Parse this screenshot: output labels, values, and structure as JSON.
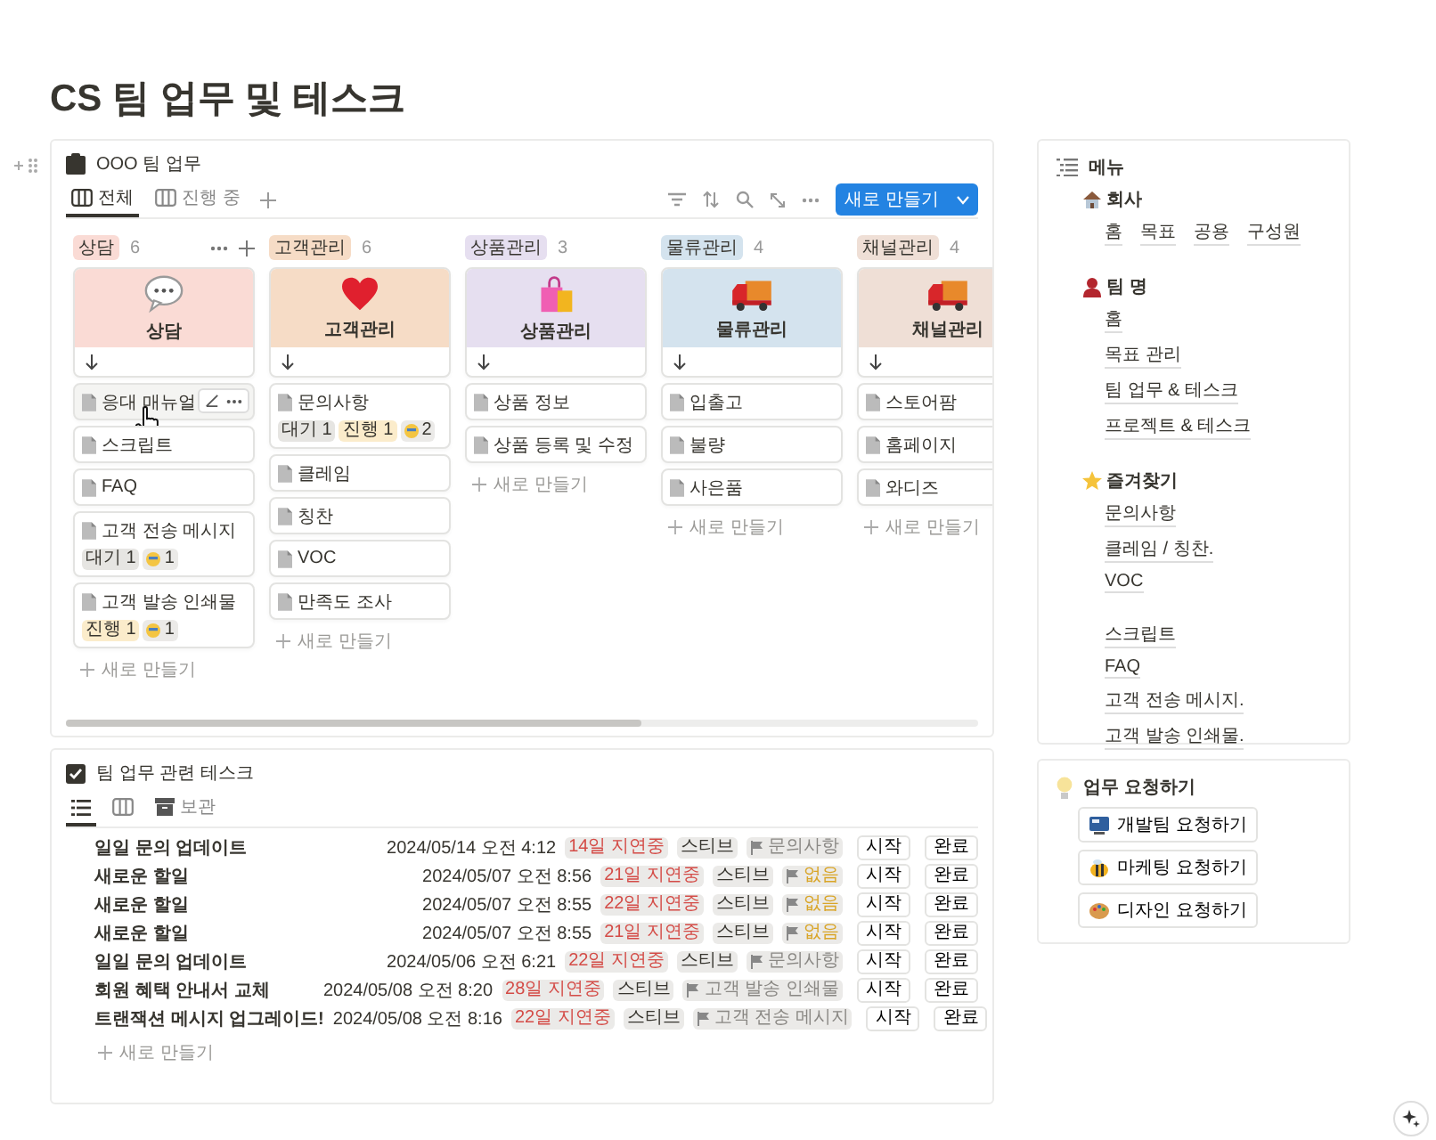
{
  "page_title": "CS 팀 업무 및 테스크",
  "board": {
    "title": "OOO 팀 업무",
    "tabs": [
      {
        "label": "전체",
        "selected": true
      },
      {
        "label": "진행 중",
        "selected": false
      }
    ],
    "new_button": "새로 만들기",
    "columns": [
      {
        "name": "상담",
        "count": "6",
        "color": "#fadbd5",
        "actions": true,
        "cover": {
          "title": "상담"
        },
        "add_label": "새로 만들기",
        "items": [
          {
            "title": "응대 매뉴얼",
            "hovered": true
          },
          {
            "title": "스크립트",
            "hovered": false
          },
          {
            "title": "FAQ",
            "hovered": false
          },
          {
            "title": "고객 전송 메시지",
            "hovered": false,
            "tags": [
              {
                "kind": "status",
                "label": "대기 1",
                "color": "#e6e5e2"
              },
              {
                "kind": "emoji",
                "label": "1"
              }
            ]
          },
          {
            "title": "고객 발송 인쇄물",
            "hovered": false,
            "tags": [
              {
                "kind": "status",
                "label": "진행 1",
                "color": "#fbeccb"
              },
              {
                "kind": "emoji",
                "label": "1"
              }
            ]
          }
        ]
      },
      {
        "name": "고객관리",
        "count": "6",
        "color": "#f6dcc6",
        "cover": {
          "title": "고객관리"
        },
        "add_label": "새로 만들기",
        "items": [
          {
            "title": "문의사항",
            "hovered": false,
            "tags": [
              {
                "kind": "status",
                "label": "대기 1",
                "color": "#e6e5e2"
              },
              {
                "kind": "status",
                "label": "진행 1",
                "color": "#fbeccb"
              },
              {
                "kind": "emoji",
                "label": "2"
              }
            ]
          },
          {
            "title": "클레임",
            "hovered": false
          },
          {
            "title": "칭찬",
            "hovered": false
          },
          {
            "title": "VOC",
            "hovered": false
          },
          {
            "title": "만족도 조사",
            "hovered": false
          }
        ]
      },
      {
        "name": "상품관리",
        "count": "3",
        "color": "#e6dff0",
        "cover": {
          "title": "상품관리"
        },
        "add_label": "새로 만들기",
        "items": [
          {
            "title": "상품 정보",
            "hovered": false
          },
          {
            "title": "상품 등록 및 수정",
            "hovered": false
          }
        ]
      },
      {
        "name": "물류관리",
        "count": "4",
        "color": "#d4e3ee",
        "cover": {
          "title": "물류관리"
        },
        "add_label": "새로 만들기",
        "items": [
          {
            "title": "입출고",
            "hovered": false
          },
          {
            "title": "불량",
            "hovered": false
          },
          {
            "title": "사은품",
            "hovered": false
          }
        ]
      },
      {
        "name": "채널관리",
        "count": "4",
        "color": "#efdfd6",
        "cover": {
          "title": "채널관리"
        },
        "add_label": "새로 만들기",
        "items": [
          {
            "title": "스토어팜",
            "hovered": false
          },
          {
            "title": "홈페이지",
            "hovered": false
          },
          {
            "title": "와디즈",
            "hovered": false
          }
        ]
      }
    ]
  },
  "tasks": {
    "title": "팀 업무 관련 테스크",
    "tabs": [
      {
        "selected": true
      },
      {
        "selected": false
      },
      {
        "label": "보관",
        "selected": false
      }
    ],
    "rows": [
      {
        "title": "일일 문의 업데이트",
        "date": "2024/05/14 오전 4:12",
        "delay": "14일 지연중",
        "assignee": "스티브",
        "category": {
          "label": "문의사항",
          "color": "#8a8884"
        },
        "buttons": [
          "시작",
          "완료"
        ]
      },
      {
        "title": "새로운 할일",
        "date": "2024/05/07 오전 8:56",
        "delay": "21일 지연중",
        "assignee": "스티브",
        "category": {
          "label": "없음",
          "color": "#d9a528"
        },
        "buttons": [
          "시작",
          "완료"
        ]
      },
      {
        "title": "새로운 할일",
        "date": "2024/05/07 오전 8:55",
        "delay": "22일 지연중",
        "assignee": "스티브",
        "category": {
          "label": "없음",
          "color": "#d9a528"
        },
        "buttons": [
          "시작",
          "완료"
        ]
      },
      {
        "title": "새로운 할일",
        "date": "2024/05/07 오전 8:55",
        "delay": "21일 지연중",
        "assignee": "스티브",
        "category": {
          "label": "없음",
          "color": "#d9a528"
        },
        "buttons": [
          "시작",
          "완료"
        ]
      },
      {
        "title": "일일 문의 업데이트",
        "date": "2024/05/06 오전 6:21",
        "delay": "22일 지연중",
        "assignee": "스티브",
        "category": {
          "label": "문의사항",
          "color": "#8a8884"
        },
        "buttons": [
          "시작",
          "완료"
        ]
      },
      {
        "title": "회원 혜택 안내서 교체",
        "date": "2024/05/08 오전 8:20",
        "delay": "28일 지연중",
        "assignee": "스티브",
        "category": {
          "label": "고객 발송 인쇄물",
          "color": "#8a8884"
        },
        "buttons": [
          "시작",
          "완료"
        ]
      },
      {
        "title": "트랜잭션 메시지 업그레이드!",
        "date": "2024/05/08 오전 8:16",
        "delay": "22일 지연중",
        "assignee": "스티브",
        "category": {
          "label": "고객 전송 메시지",
          "color": "#8a8884"
        },
        "buttons": [
          "시작",
          "완료"
        ]
      }
    ],
    "add_label": "새로 만들기"
  },
  "menu": {
    "title": "메뉴",
    "sections": [
      {
        "title": "회사",
        "kind": "inline",
        "links": [
          "홈",
          "목표",
          "공용",
          "구성원"
        ]
      },
      {
        "title": "팀 명",
        "kind": "stacked",
        "links": [
          "홈",
          "목표 관리",
          "팀 업무 & 테스크",
          "프로젝트 & 테스크"
        ]
      },
      {
        "title": "즐겨찾기",
        "kind": "stacked",
        "links": [
          "문의사항",
          "클레임 / 칭찬.",
          "VOC"
        ]
      },
      {
        "kind": "stacked",
        "links": [
          "스크립트",
          "FAQ",
          "고객 전송 메시지.",
          "고객 발송 인쇄물."
        ]
      }
    ]
  },
  "requests": {
    "title": "업무 요청하기",
    "buttons": [
      "개발팀 요청하기",
      "마케팅 요청하기",
      "디자인 요청하기"
    ]
  }
}
